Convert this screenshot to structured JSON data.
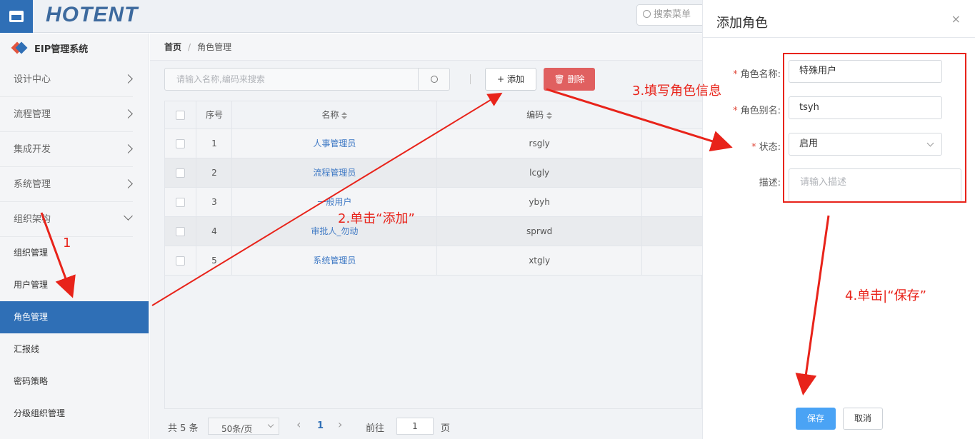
{
  "topbar": {
    "logo": "HOTENT",
    "search_placeholder": "搜索菜单"
  },
  "sidebar": {
    "brand": "EIP管理系统",
    "sections": [
      {
        "label": "设计中心",
        "expanded": false
      },
      {
        "label": "流程管理",
        "expanded": false
      },
      {
        "label": "集成开发",
        "expanded": false
      },
      {
        "label": "系统管理",
        "expanded": false
      },
      {
        "label": "组织架构",
        "expanded": true
      }
    ],
    "items": [
      "组织管理",
      "用户管理",
      "角色管理",
      "汇报线",
      "密码策略",
      "分级组织管理"
    ],
    "active_item": "角色管理"
  },
  "breadcrumb": {
    "home": "首页",
    "sep": "/",
    "current": "角色管理"
  },
  "toolbar": {
    "search_placeholder": "请输入名称,编码来搜索",
    "add_label": "添加",
    "add_icon": "+",
    "delete_label": "删除",
    "delete_icon": "trash-icon"
  },
  "table": {
    "headers": {
      "index": "序号",
      "name": "名称",
      "code": "编码"
    },
    "rows": [
      {
        "index": "1",
        "name": "人事管理员",
        "code": "rsgly"
      },
      {
        "index": "2",
        "name": "流程管理员",
        "code": "lcgly"
      },
      {
        "index": "3",
        "name": "一般用户",
        "code": "ybyh"
      },
      {
        "index": "4",
        "name": "审批人_勿动",
        "code": "sprwd"
      },
      {
        "index": "5",
        "name": "系统管理员",
        "code": "xtgly"
      }
    ]
  },
  "pager": {
    "total": "共 5 条",
    "page_size": "50条/页",
    "prev": "‹",
    "current": "1",
    "next": "›",
    "goto_prefix": "前往",
    "goto_value": "1",
    "goto_suffix": "页"
  },
  "drawer": {
    "title": "添加角色",
    "close": "×",
    "fields": {
      "name_label": "角色名称:",
      "name_value": "特殊用户",
      "alias_label": "角色别名:",
      "alias_value": "tsyh",
      "status_label": "状态:",
      "status_value": "启用",
      "desc_label": "描述:",
      "desc_placeholder": "请输入描述"
    },
    "save_label": "保存",
    "cancel_label": "取消"
  },
  "annotations": {
    "step1": "1",
    "step2": "2.单击“添加”",
    "step3": "3.填写角色信息",
    "step4": "4.单击|“保存”",
    "color": "#e8231a"
  }
}
